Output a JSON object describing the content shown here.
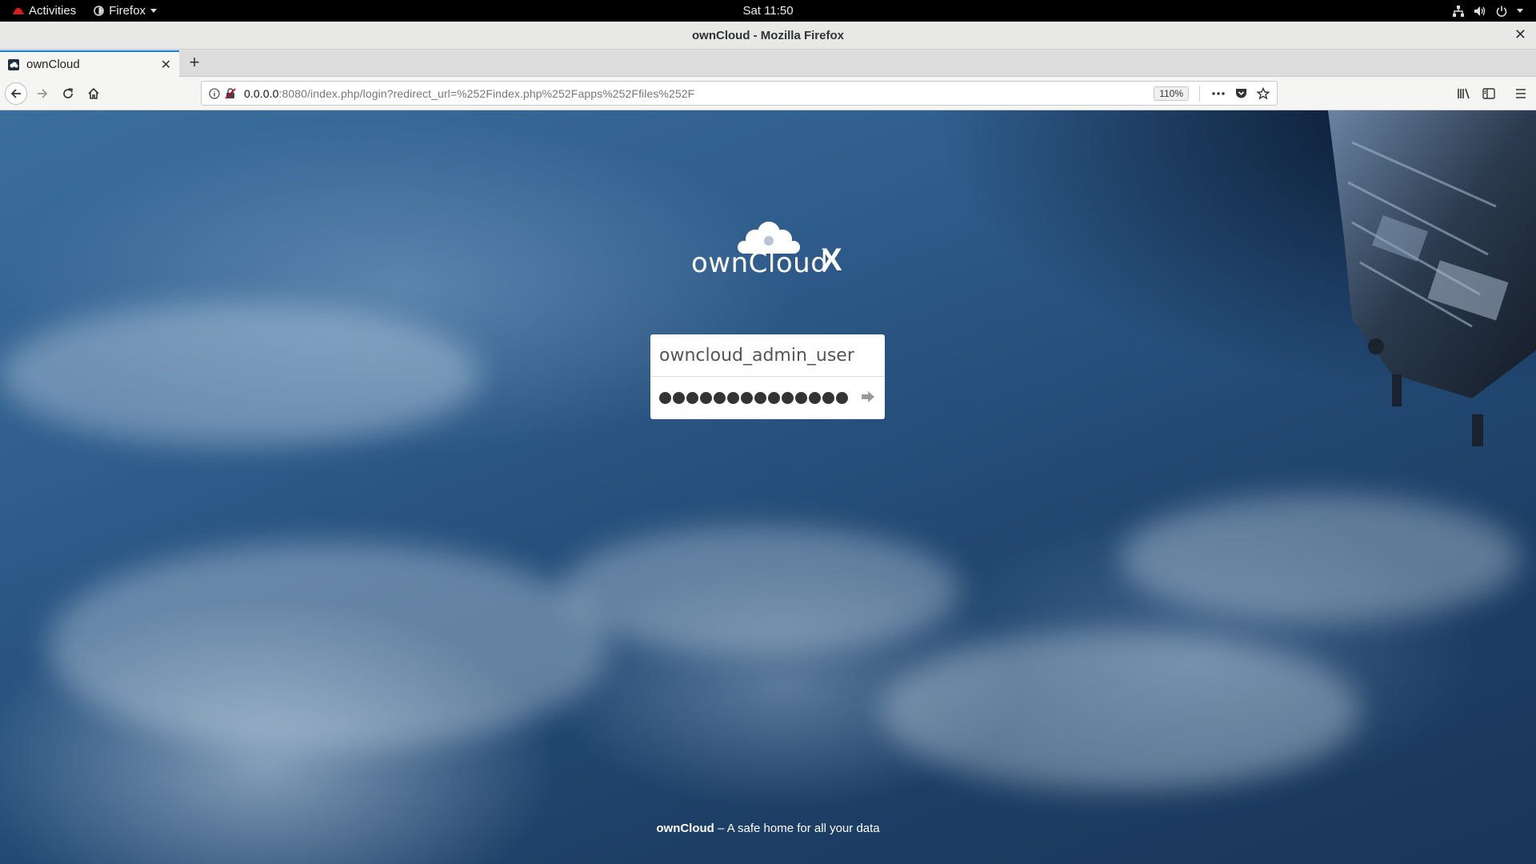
{
  "system_bar": {
    "activities": "Activities",
    "app_name": "Firefox",
    "clock": "Sat 11:50",
    "tray_icons": [
      "network-icon",
      "volume-icon",
      "power-icon"
    ]
  },
  "window": {
    "title": "ownCloud - Mozilla Firefox"
  },
  "tabs": [
    {
      "title": "ownCloud",
      "active": true
    }
  ],
  "navbar": {
    "url_host": "0.0.0.0",
    "url_rest": ":8080/index.php/login?redirect_url=%252Findex.php%252Fapps%252Ffiles%252F",
    "zoom": "110%"
  },
  "page": {
    "logo_text": "ownCloud",
    "logo_suffix": "X",
    "username_value": "owncloud_admin_user",
    "password_mask_count": 14,
    "footer_brand": "ownCloud",
    "footer_tagline": " – A safe home for all your data"
  },
  "colors": {
    "accent": "#0a84ff",
    "topbar_bg": "#000000",
    "page_blue": "#2f5d8c"
  }
}
